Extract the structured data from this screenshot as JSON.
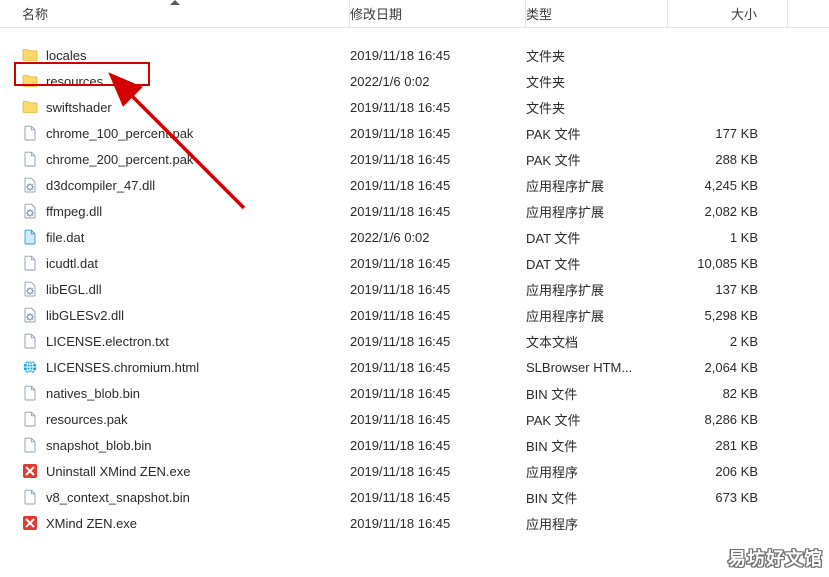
{
  "columns": {
    "name": "名称",
    "date": "修改日期",
    "type": "类型",
    "size": "大小"
  },
  "rows": [
    {
      "icon": "folder",
      "name": "locales",
      "date": "2019/11/18 16:45",
      "type": "文件夹",
      "size": ""
    },
    {
      "icon": "folder",
      "name": "resources",
      "date": "2022/1/6 0:02",
      "type": "文件夹",
      "size": ""
    },
    {
      "icon": "folder",
      "name": "swiftshader",
      "date": "2019/11/18 16:45",
      "type": "文件夹",
      "size": ""
    },
    {
      "icon": "file",
      "name": "chrome_100_percent.pak",
      "date": "2019/11/18 16:45",
      "type": "PAK 文件",
      "size": "177 KB"
    },
    {
      "icon": "file",
      "name": "chrome_200_percent.pak",
      "date": "2019/11/18 16:45",
      "type": "PAK 文件",
      "size": "288 KB"
    },
    {
      "icon": "dll",
      "name": "d3dcompiler_47.dll",
      "date": "2019/11/18 16:45",
      "type": "应用程序扩展",
      "size": "4,245 KB"
    },
    {
      "icon": "dll",
      "name": "ffmpeg.dll",
      "date": "2019/11/18 16:45",
      "type": "应用程序扩展",
      "size": "2,082 KB"
    },
    {
      "icon": "dat",
      "name": "file.dat",
      "date": "2022/1/6 0:02",
      "type": "DAT 文件",
      "size": "1 KB"
    },
    {
      "icon": "file",
      "name": "icudtl.dat",
      "date": "2019/11/18 16:45",
      "type": "DAT 文件",
      "size": "10,085 KB"
    },
    {
      "icon": "dll",
      "name": "libEGL.dll",
      "date": "2019/11/18 16:45",
      "type": "应用程序扩展",
      "size": "137 KB"
    },
    {
      "icon": "dll",
      "name": "libGLESv2.dll",
      "date": "2019/11/18 16:45",
      "type": "应用程序扩展",
      "size": "5,298 KB"
    },
    {
      "icon": "file",
      "name": "LICENSE.electron.txt",
      "date": "2019/11/18 16:45",
      "type": "文本文档",
      "size": "2 KB"
    },
    {
      "icon": "html",
      "name": "LICENSES.chromium.html",
      "date": "2019/11/18 16:45",
      "type": "SLBrowser HTM...",
      "size": "2,064 KB"
    },
    {
      "icon": "file",
      "name": "natives_blob.bin",
      "date": "2019/11/18 16:45",
      "type": "BIN 文件",
      "size": "82 KB"
    },
    {
      "icon": "file",
      "name": "resources.pak",
      "date": "2019/11/18 16:45",
      "type": "PAK 文件",
      "size": "8,286 KB"
    },
    {
      "icon": "file",
      "name": "snapshot_blob.bin",
      "date": "2019/11/18 16:45",
      "type": "BIN 文件",
      "size": "281 KB"
    },
    {
      "icon": "xmind",
      "name": "Uninstall XMind ZEN.exe",
      "date": "2019/11/18 16:45",
      "type": "应用程序",
      "size": "206 KB"
    },
    {
      "icon": "file",
      "name": "v8_context_snapshot.bin",
      "date": "2019/11/18 16:45",
      "type": "BIN 文件",
      "size": "673 KB"
    },
    {
      "icon": "xmind",
      "name": "XMind ZEN.exe",
      "date": "2019/11/18 16:45",
      "type": "应用程序",
      "size": ""
    }
  ],
  "annotation": {
    "highlight_row_index": 1,
    "arrow_color": "#d40000"
  },
  "watermark": "易坊好文馆"
}
